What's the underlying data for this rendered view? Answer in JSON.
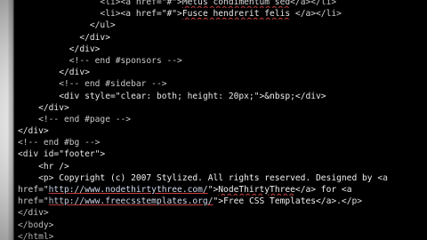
{
  "editor": {
    "lines": [
      {
        "indent": "                ",
        "segments": [
          {
            "text": "<li><a href=\"#\">",
            "cls": "t-tag"
          },
          {
            "text": "Metus condimentum sed",
            "cls": "t-text t-spell"
          },
          {
            "text": "</a></li>",
            "cls": "t-tag"
          }
        ]
      },
      {
        "indent": "                ",
        "segments": [
          {
            "text": "<li><a href=\"#\">",
            "cls": "t-tag"
          },
          {
            "text": "Fusce hendrerit felis",
            "cls": "t-text t-spell"
          },
          {
            "text": " </a></li>",
            "cls": "t-tag"
          }
        ]
      },
      {
        "indent": "              ",
        "segments": [
          {
            "text": "</ul>",
            "cls": "t-tag"
          }
        ]
      },
      {
        "indent": "            ",
        "segments": [
          {
            "text": "</div>",
            "cls": "t-tag"
          }
        ]
      },
      {
        "indent": "          ",
        "segments": [
          {
            "text": "</div>",
            "cls": "t-tag"
          }
        ]
      },
      {
        "indent": "          ",
        "segments": [
          {
            "text": "<!-- end #sponsors -->",
            "cls": "t-comment"
          }
        ]
      },
      {
        "indent": "        ",
        "segments": [
          {
            "text": "</div>",
            "cls": "t-tag"
          }
        ]
      },
      {
        "indent": "        ",
        "segments": [
          {
            "text": "<!-- end #sidebar -->",
            "cls": "t-comment"
          }
        ]
      },
      {
        "indent": "        ",
        "segments": [
          {
            "text": "<div style=\"clear: both; height: 20px;\">",
            "cls": "t-tag"
          },
          {
            "text": "&nbsp;",
            "cls": "t-text"
          },
          {
            "text": "</div>",
            "cls": "t-tag"
          }
        ]
      },
      {
        "indent": "    ",
        "segments": [
          {
            "text": "</div>",
            "cls": "t-tag"
          }
        ]
      },
      {
        "indent": "    ",
        "segments": [
          {
            "text": "<!-- end #page -->",
            "cls": "t-comment"
          }
        ]
      },
      {
        "indent": "",
        "segments": [
          {
            "text": "</div>",
            "cls": "t-tag"
          }
        ]
      },
      {
        "indent": "",
        "segments": [
          {
            "text": "<!-- end #bg -->",
            "cls": "t-comment"
          }
        ]
      },
      {
        "indent": "",
        "segments": [
          {
            "text": "<div id=\"footer\">",
            "cls": "t-tag"
          }
        ]
      },
      {
        "indent": "    ",
        "segments": [
          {
            "text": "<hr />",
            "cls": "t-tag"
          }
        ]
      },
      {
        "indent": "    ",
        "segments": [
          {
            "text": "<p>",
            "cls": "t-tag"
          },
          {
            "text": " Copyright (c) 2007 Stylized. All rights reserved. Designed by ",
            "cls": "t-text"
          },
          {
            "text": "<a",
            "cls": "t-tag"
          }
        ]
      },
      {
        "indent": "",
        "segments": [
          {
            "text": "href=\"",
            "cls": "t-attr"
          },
          {
            "text": "http://www.nodethirtythree.com/",
            "cls": "t-link"
          },
          {
            "text": "\">",
            "cls": "t-attr"
          },
          {
            "text": "NodeThirtyThree",
            "cls": "t-text t-spell"
          },
          {
            "text": "</a>",
            "cls": "t-tag"
          },
          {
            "text": " for ",
            "cls": "t-text"
          },
          {
            "text": "<a",
            "cls": "t-tag"
          }
        ]
      },
      {
        "indent": "",
        "segments": [
          {
            "text": "href=\"",
            "cls": "t-attr"
          },
          {
            "text": "http://www.freecsstemplates.org/",
            "cls": "t-link"
          },
          {
            "text": "\">",
            "cls": "t-attr"
          },
          {
            "text": "Free CSS Templates",
            "cls": "t-text"
          },
          {
            "text": "</a>",
            "cls": "t-tag"
          },
          {
            "text": ".",
            "cls": "t-text"
          },
          {
            "text": "</p>",
            "cls": "t-tag"
          }
        ]
      },
      {
        "indent": "",
        "segments": [
          {
            "text": "</div>",
            "cls": "t-tag"
          }
        ]
      },
      {
        "indent": "",
        "segments": [
          {
            "text": "</body>",
            "cls": "t-tag"
          }
        ]
      },
      {
        "indent": "",
        "segments": [
          {
            "text": "</html>",
            "cls": "t-tag"
          }
        ]
      }
    ]
  },
  "colors": {
    "background": "#000000",
    "text": "#d9d9d9",
    "spellcheck": "#c84040"
  }
}
